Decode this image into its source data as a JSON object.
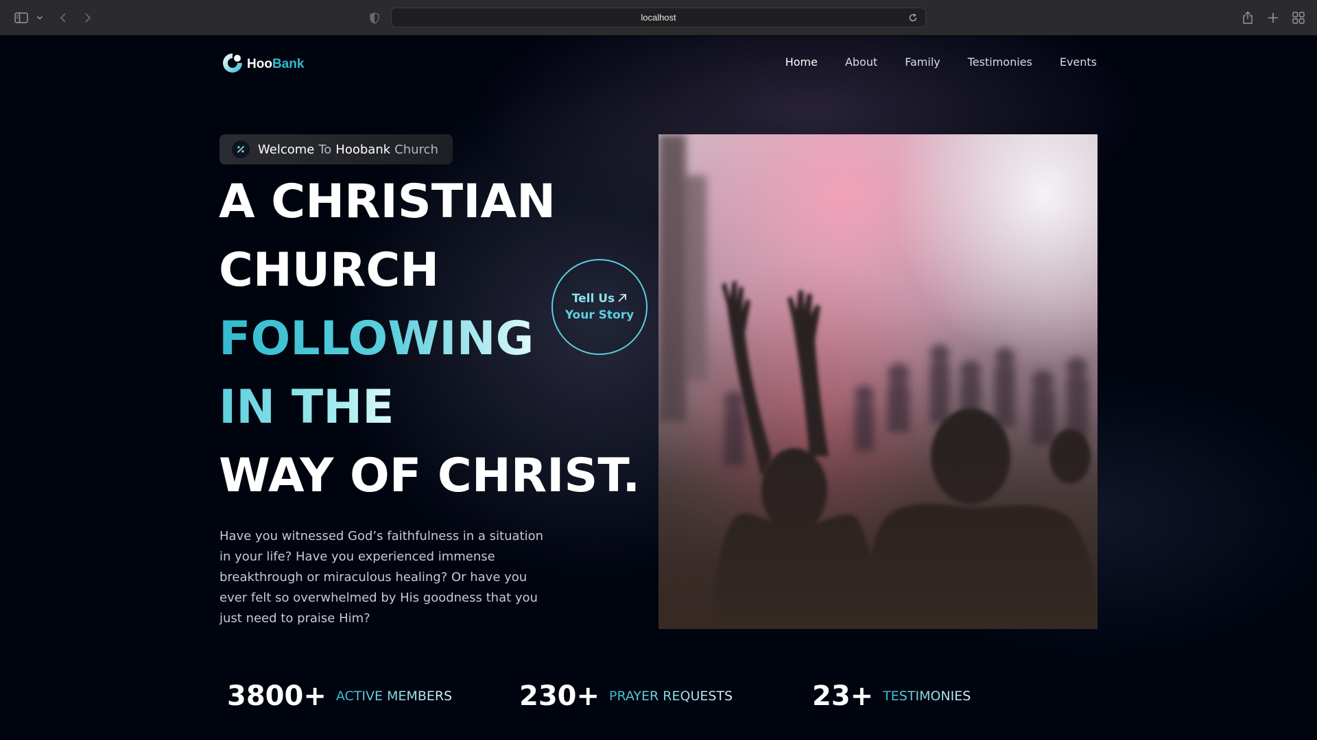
{
  "browser": {
    "url": "localhost",
    "icons": [
      "sidebar-icon",
      "chevron-down-icon",
      "back-icon",
      "forward-icon",
      "shield-icon",
      "reload-icon",
      "share-icon",
      "new-tab-icon",
      "tab-overview-icon"
    ]
  },
  "brand": {
    "name_part1": "Hoo",
    "name_part2": "Bank",
    "accent": "#33bbcf",
    "background": "#00040f"
  },
  "nav": {
    "items": [
      {
        "label": "Home",
        "active": true
      },
      {
        "label": "About",
        "active": false
      },
      {
        "label": "Family",
        "active": false
      },
      {
        "label": "Testimonies",
        "active": false
      },
      {
        "label": "Events",
        "active": false
      }
    ]
  },
  "welcome": {
    "w1": "Welcome",
    "w2": "To",
    "w3": "Hoobank",
    "w4": "Church",
    "icon": "discount-icon"
  },
  "hero": {
    "line1": "A CHRISTIAN",
    "line2": "CHURCH",
    "line3": "FOLLOWING",
    "line4": "IN THE",
    "line5": "WAY OF CHRIST.",
    "description": "Have you witnessed God’s faithfulness in a situation in your life? Have you experienced immense breakthrough or miraculous healing? Or have you ever felt so overwhelmed by His goodness that you just need to praise Him?"
  },
  "cta": {
    "line1": "Tell Us",
    "line2": "Your Story",
    "icon": "arrow-up-right-icon"
  },
  "stats": [
    {
      "number": "3800+",
      "label": "Active Members"
    },
    {
      "number": "230+",
      "label": "Prayer Requests"
    },
    {
      "number": "23+",
      "label": "Testimonies"
    }
  ]
}
